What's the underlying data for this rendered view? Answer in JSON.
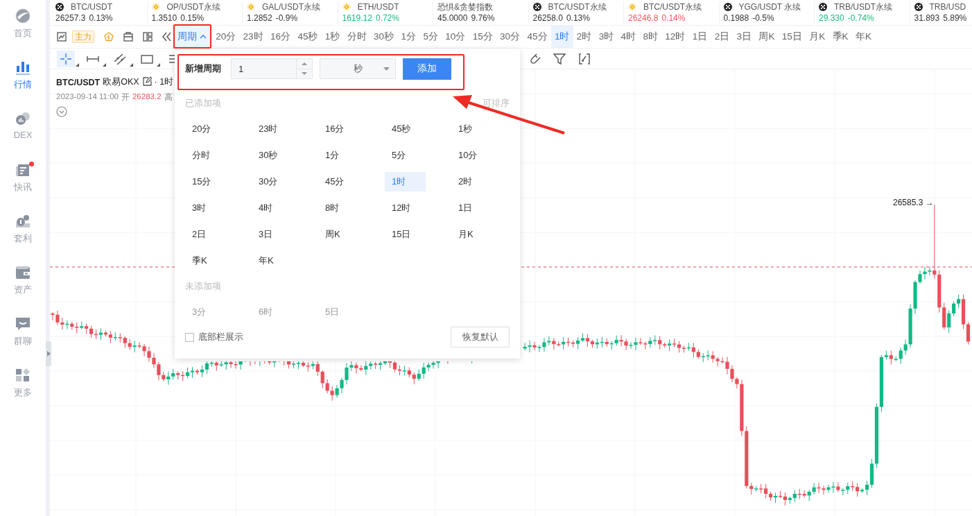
{
  "sidebar": {
    "items": [
      {
        "kind": "home",
        "label": "首页",
        "selected": false,
        "has_dot": false
      },
      {
        "kind": "market",
        "label": "行情",
        "selected": true,
        "has_dot": false
      },
      {
        "kind": "dex",
        "label": "DEX",
        "selected": false,
        "has_dot": false
      },
      {
        "kind": "news",
        "label": "快讯",
        "selected": false,
        "has_dot": true
      },
      {
        "kind": "arbitrage",
        "label": "套利",
        "selected": false,
        "has_dot": false
      },
      {
        "kind": "assets",
        "label": "资产",
        "selected": false,
        "has_dot": false
      },
      {
        "kind": "chat",
        "label": "群聊",
        "selected": false,
        "has_dot": false
      },
      {
        "kind": "more",
        "label": "更多",
        "selected": false,
        "has_dot": false
      }
    ]
  },
  "ticker": [
    {
      "kind": "okx",
      "name": "BTC/USDT",
      "price": "26257.3",
      "change": "0.13%",
      "color": "#333333"
    },
    {
      "kind": "bnb",
      "name": "OP/USDT永续",
      "price": "1.3510",
      "change": "0.15%",
      "color": "#333333"
    },
    {
      "kind": "bnb",
      "name": "GAL/USDT永续",
      "price": "1.2852",
      "change": "-0.9%",
      "color": "#333333"
    },
    {
      "kind": "bnb",
      "name": "ETH/USDT",
      "price": "1619.12",
      "change": "0.72%",
      "color": "#1bba7d"
    },
    {
      "kind": "none",
      "name": "恐惧&贪婪指数",
      "price": "45.0000",
      "change": "9.76%",
      "color": "#333333"
    },
    {
      "kind": "okx",
      "name": "BTC/USDT永续",
      "price": "26258.0",
      "change": "0.13%",
      "color": "#333333"
    },
    {
      "kind": "bnb",
      "name": "BTC/USDT永续",
      "price": "26246.8",
      "change": "0.14%",
      "color": "#f0565a"
    },
    {
      "kind": "okx",
      "name": "YGG/USDT 永续",
      "price": "0.1988",
      "change": "-0.5%",
      "color": "#333333"
    },
    {
      "kind": "okx",
      "name": "TRB/USDT永续",
      "price": "29.330",
      "change": "-0.74%",
      "color": "#1bba7d"
    },
    {
      "kind": "okx",
      "name": "TRB/USD",
      "price": "31.893",
      "change": "5.89%",
      "color": "#333333"
    }
  ],
  "period_bar": {
    "main_badge": "主力",
    "period_button": {
      "label": "周期",
      "expanded": true
    },
    "periods": [
      {
        "label": "20分",
        "selected": false
      },
      {
        "label": "23时",
        "selected": false
      },
      {
        "label": "16分",
        "selected": false
      },
      {
        "label": "45秒",
        "selected": false
      },
      {
        "label": "1秒",
        "selected": false
      },
      {
        "label": "分时",
        "selected": false
      },
      {
        "label": "30秒",
        "selected": false
      },
      {
        "label": "1分",
        "selected": false
      },
      {
        "label": "5分",
        "selected": false
      },
      {
        "label": "10分",
        "selected": false
      },
      {
        "label": "15分",
        "selected": false
      },
      {
        "label": "30分",
        "selected": false
      },
      {
        "label": "45分",
        "selected": false
      },
      {
        "label": "1时",
        "selected": true
      },
      {
        "label": "2时",
        "selected": false
      },
      {
        "label": "3时",
        "selected": false
      },
      {
        "label": "4时",
        "selected": false
      },
      {
        "label": "8时",
        "selected": false
      },
      {
        "label": "12时",
        "selected": false
      },
      {
        "label": "1日",
        "selected": false
      },
      {
        "label": "2日",
        "selected": false
      },
      {
        "label": "3日",
        "selected": false
      },
      {
        "label": "周K",
        "selected": false
      },
      {
        "label": "15日",
        "selected": false
      },
      {
        "label": "月K",
        "selected": false
      },
      {
        "label": "季K",
        "selected": false
      },
      {
        "label": "年K",
        "selected": false
      }
    ]
  },
  "drawing_tools": [
    {
      "kind": "crosshair",
      "selected": true
    },
    {
      "kind": "horizontal-line",
      "selected": false
    },
    {
      "kind": "parallel-lines",
      "selected": false
    },
    {
      "kind": "rectangle",
      "selected": false
    },
    {
      "kind": "text-lines",
      "selected": false
    }
  ],
  "chart_tools": [
    {
      "kind": "magnet"
    },
    {
      "kind": "filter"
    },
    {
      "kind": "reset"
    }
  ],
  "chart": {
    "symbol": "BTC/USDT",
    "exchange": "欧易OKX",
    "interval": "· 1时",
    "date": "2023-09-14 11:00",
    "open_label": "开",
    "open": "26283.2",
    "high_label": "高",
    "peak_label": "26585.3 →"
  },
  "popup": {
    "add_label": "新增周期",
    "count_value": "1",
    "unit": "秒",
    "add_button": "添加",
    "added_heading": "已添加项",
    "sort_hint": "可排序",
    "added": [
      {
        "label": "20分",
        "selected": false
      },
      {
        "label": "23时",
        "selected": false
      },
      {
        "label": "16分",
        "selected": false
      },
      {
        "label": "45秒",
        "selected": false
      },
      {
        "label": "1秒",
        "selected": false
      },
      {
        "label": "分时",
        "selected": false
      },
      {
        "label": "30秒",
        "selected": false
      },
      {
        "label": "1分",
        "selected": false
      },
      {
        "label": "5分",
        "selected": false
      },
      {
        "label": "10分",
        "selected": false
      },
      {
        "label": "15分",
        "selected": false
      },
      {
        "label": "30分",
        "selected": false
      },
      {
        "label": "45分",
        "selected": false
      },
      {
        "label": "1时",
        "selected": true
      },
      {
        "label": "2时",
        "selected": false
      },
      {
        "label": "3时",
        "selected": false
      },
      {
        "label": "4时",
        "selected": false
      },
      {
        "label": "8时",
        "selected": false
      },
      {
        "label": "12时",
        "selected": false
      },
      {
        "label": "1日",
        "selected": false
      },
      {
        "label": "2日",
        "selected": false
      },
      {
        "label": "3日",
        "selected": false
      },
      {
        "label": "周K",
        "selected": false
      },
      {
        "label": "15日",
        "selected": false
      },
      {
        "label": "月K",
        "selected": false
      },
      {
        "label": "季K",
        "selected": false
      },
      {
        "label": "年K",
        "selected": false
      }
    ],
    "not_added_heading": "未添加项",
    "not_added": [
      {
        "label": "3分"
      },
      {
        "label": "6时"
      },
      {
        "label": "5日"
      }
    ],
    "bottom_bar": {
      "label": "底部栏展示",
      "checked": false
    },
    "reset_button": "恢复默认"
  }
}
